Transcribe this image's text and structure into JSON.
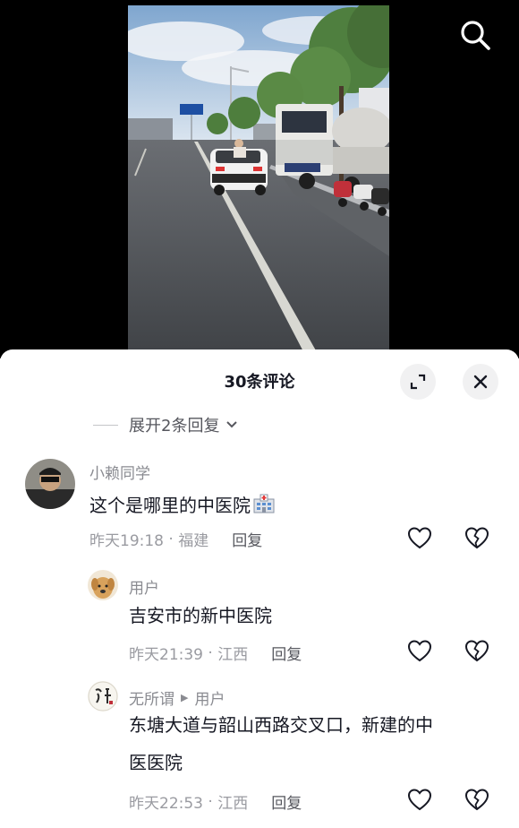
{
  "video": {
    "search_icon": "search-icon"
  },
  "comments_panel": {
    "title": "30条评论",
    "expand_replies_label": "展开2条回复",
    "comments": [
      {
        "user": "小赖同学",
        "text": "这个是哪里的中医院",
        "time": "昨天19:18",
        "location": "福建",
        "reply_label": "回复"
      },
      {
        "user": "用户",
        "text": "吉安市的新中医院",
        "time": "昨天21:39",
        "location": "江西",
        "reply_label": "回复"
      },
      {
        "user": "无所谓",
        "reply_to": "用户",
        "text_line1": "东塘大道与韶山西路交叉口，新建的中",
        "text_line2": "医医院",
        "time": "昨天22:53",
        "location": "江西",
        "reply_label": "回复"
      }
    ]
  },
  "colors": {
    "sheet_bg": "#ffffff",
    "primary_text": "#161823",
    "secondary_text": "#8a8b91",
    "button_bg": "#f1f1f2"
  }
}
